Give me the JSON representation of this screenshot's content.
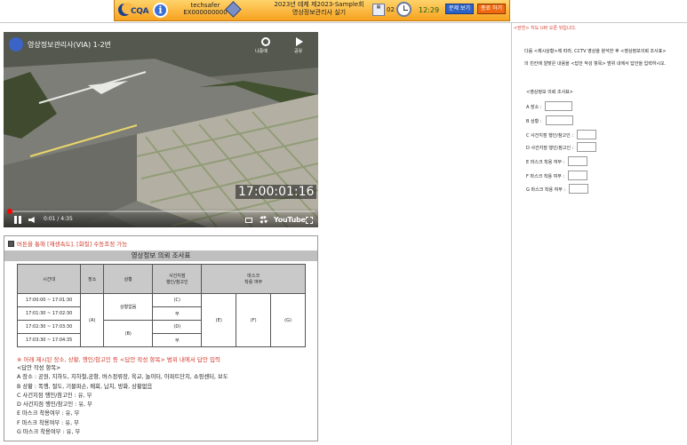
{
  "header": {
    "logo_text": "CQA",
    "user_id": "techsafer",
    "user_number": "EX000000000",
    "exam_title_line1": "2023년 테제 제2023-Sample회",
    "exam_title_line2": "영상정보관리사 실기",
    "page_count": "02",
    "time_remaining": "12:29",
    "btn_problem_view": "문제 보기",
    "btn_close": "종료 하기"
  },
  "video": {
    "title": "영상정보관리사(VIA) 1-2번",
    "watch_later": "나중에",
    "share": "공유",
    "overlay_timestamp": "17:00:01:16",
    "elapsed": "0:01 / 4:35",
    "brand": "YouTube",
    "progress": 0.004
  },
  "survey": {
    "notice": "버튼을 통해 [재생속도], [화질] 수동조정 가능",
    "title": "영상정보 의뢰 조사표",
    "headers": [
      "시간대",
      "장소",
      "상황",
      "사건지점\n행인/참고인",
      "마스크\n착용 여부"
    ],
    "times": [
      "17:00:00 ~ 17:01:30",
      "17:01:30 ~ 17:02:30",
      "17:02:30 ~ 17:03:30",
      "17:03:30 ~ 17:04:35"
    ],
    "place_cell": "(A)",
    "situation_none": "상황없음",
    "situation_b": "(B)",
    "suspect": [
      "(C)",
      "무",
      "(D)",
      "무"
    ],
    "mask": [
      "(E)",
      "(F)",
      "(G)"
    ],
    "warning": "※ 아래 제시된 장소, 상황, 행인/참고인 등 <답안 작성 항목> 범위 내에서 답안 입력",
    "answer_header": "<답안 작성 항목>",
    "answer_items": [
      "A 장소 : 공원, 지하도, 지하철,공항, 버스정류장, 육교, 놀이터, 아파트단지, 쇼핑센터, 보도",
      "B 상황 : 폭행, 절도, 기물파손, 배회, 납치, 방화, 상황없음",
      "C 사건지점 행인/참고인 : 유, 무",
      "D 사건지점 행인/참고인 : 유, 무",
      "E 마스크 착용여부 : 유, 무",
      "F 마스크 착용여부 : 유, 무",
      "G 마스크 착용여부 : 유, 무"
    ]
  },
  "right_panel": {
    "link": "<닫힌> 지도 U바 오른 뒤입니다.",
    "instruction1": "다음 <제시상황>에 따라, CCTV 영상을 분석한 후 <영상정보의뢰 조사표>",
    "instruction2": "의 빈칸에 알맞은 내용을 <답안 작성 항목> 범위 내에서 답안을 입력하시오.",
    "form_title": "<영상정보 의뢰 조사표>",
    "fields": [
      {
        "label": "A 장소 :",
        "value": ""
      },
      {
        "label": "B 상황 :",
        "value": ""
      },
      {
        "label": "C 사건지점 행인/참고인 :",
        "value": ""
      },
      {
        "label": "D 사건지점 행인/참고인 :",
        "value": ""
      },
      {
        "label": "E 마스크 착용 여부 :",
        "value": ""
      },
      {
        "label": "F 마스크 착용 여부 :",
        "value": ""
      },
      {
        "label": "G 마스크 착용 여부 :",
        "value": ""
      }
    ]
  }
}
